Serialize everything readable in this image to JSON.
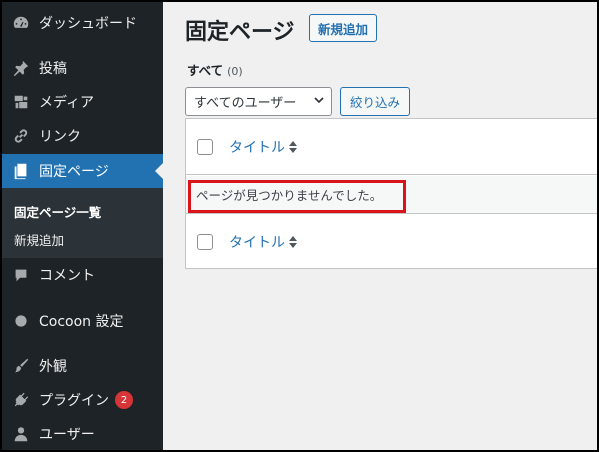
{
  "sidebar": {
    "items": [
      {
        "label": "ダッシュボード",
        "icon": "dashboard-icon"
      },
      {
        "label": "投稿",
        "icon": "pin-icon"
      },
      {
        "label": "メディア",
        "icon": "media-icon"
      },
      {
        "label": "リンク",
        "icon": "link-icon"
      },
      {
        "label": "固定ページ",
        "icon": "pages-icon"
      },
      {
        "label": "コメント",
        "icon": "comment-icon"
      },
      {
        "label": "Cocoon 設定",
        "icon": "circle-icon"
      },
      {
        "label": "外観",
        "icon": "brush-icon"
      },
      {
        "label": "プラグイン",
        "icon": "plugin-icon",
        "badge": "2"
      },
      {
        "label": "ユーザー",
        "icon": "user-icon"
      }
    ],
    "submenu": [
      "固定ページ一覧",
      "新規追加"
    ]
  },
  "main": {
    "title": "固定ページ",
    "add_button": "新規追加",
    "filter": {
      "label": "すべて",
      "count": "(0)"
    },
    "author_select": "すべてのユーザー",
    "filter_button": "絞り込み",
    "column_title": "タイトル",
    "empty_message": "ページが見つかりませんでした。"
  },
  "colors": {
    "accent": "#2271b1",
    "sidebar": "#1d2327",
    "highlight": "#d9151b",
    "badge": "#d63638"
  }
}
